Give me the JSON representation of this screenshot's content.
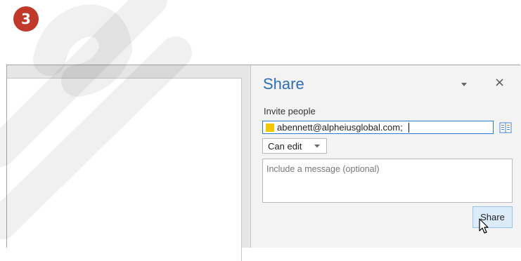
{
  "step_badge": "3",
  "pane": {
    "title": "Share",
    "dropdown_icon": "chevron-down-icon",
    "close_icon": "close-icon",
    "close_glyph": "×"
  },
  "invite": {
    "label": "Invite people",
    "value": "abennett@alpheiusglobal.com;",
    "presence_color": "#f2c800",
    "address_book_icon": "address-book-icon"
  },
  "permission": {
    "selected": "Can edit"
  },
  "message": {
    "placeholder": "Include a message (optional)"
  },
  "share_button": {
    "label": "Share"
  },
  "colors": {
    "accent": "#2e6fb5",
    "badge": "#c0392b",
    "input_focus": "#2b7bd4",
    "button_bg": "#dcebfa"
  }
}
